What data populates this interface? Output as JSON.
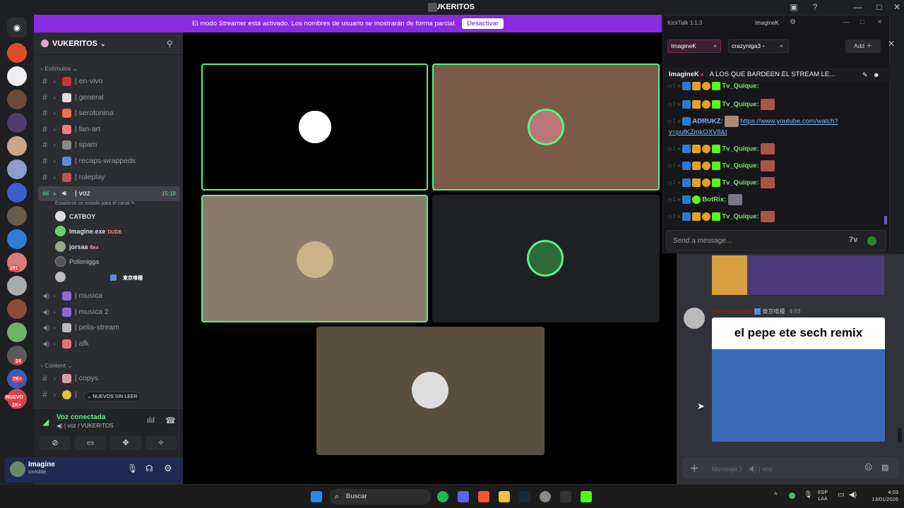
{
  "window": {
    "title": "VUKERITOS",
    "minimize": "—",
    "maximize": "□",
    "close": "✕"
  },
  "banner": {
    "text": "El modo Streamer está activado. Los nombres de usuario se mostrarán de forma parcial.",
    "button": "Desactivar"
  },
  "server": {
    "name": "VUKERITOS"
  },
  "rail": {
    "badges": [
      "281",
      "24",
      "7K+",
      "NUEVO",
      "1K+"
    ]
  },
  "sidebar": {
    "categories": [
      {
        "label": "Estímulos"
      },
      {
        "label": "Content"
      }
    ],
    "text_channels": [
      "| en-vivo",
      "| general",
      "| serotonina",
      "| fan-art",
      "| spam",
      "| recaps-wrappeds",
      "| roleplay"
    ],
    "voice_channel": {
      "name": "| voz",
      "time": "15:18",
      "status": "Establece un estado para el canal"
    },
    "voice_users": [
      {
        "name": "CATBOY",
        "tag": ""
      },
      {
        "name": "Imagine.exe",
        "tag": "DUDE"
      },
      {
        "name": "jorsaa",
        "tag": "flex"
      },
      {
        "name": "Pollonigga",
        "tag": ""
      },
      {
        "name": "",
        "tag": "東京喰種"
      }
    ],
    "voice_channels": [
      "| musica",
      "| musica 2",
      "| pelis-stream",
      "| afk"
    ],
    "content_channels": [
      "| copys",
      "|"
    ],
    "new_unread": "NUEVOS SIN LEER"
  },
  "voice": {
    "status": "Voz conectada",
    "location": "voz / VUKERITOS"
  },
  "user": {
    "name": "Imagine",
    "status": "Invisible"
  },
  "kicktalk": {
    "title": "KickTalk 1.1.3",
    "account": "ImagineK",
    "tabs": [
      {
        "label": "ImagineK"
      },
      {
        "label": "crazyniga3"
      }
    ],
    "add_button": "Add",
    "pinned": {
      "user": "ImagineK",
      "text": "A LOS QUE BARDEEN EL STREAM LE..."
    },
    "messages": [
      {
        "user": "Tv_Quique:",
        "link": ""
      },
      {
        "user": "Tv_Quique:",
        "link": ""
      },
      {
        "user": "ADRUKZ:",
        "link": "https://www.youtube.com/watch?",
        "link2": "v=pufKZmkOXV8&t"
      },
      {
        "user": "Tv_Quique:",
        "link": ""
      },
      {
        "user": "Tv_Quique:",
        "link": ""
      },
      {
        "user": "Tv_Quique:",
        "link": ""
      },
      {
        "user": "BotRix:",
        "link": ""
      },
      {
        "user": "Tv_Quique:",
        "link": ""
      }
    ],
    "input_placeholder": "Send a message..."
  },
  "chat": {
    "message": {
      "tag": "東京喰種",
      "time": "4:03",
      "image_caption": "el pepe ete sech remix"
    },
    "input_placeholder": "Mensaje",
    "input_channel": "| voz"
  },
  "taskbar": {
    "search": "Buscar",
    "lang1": "ESP",
    "lang2": "LAA",
    "time": "4:03",
    "date": "13/01/2026"
  },
  "colors": {
    "banner": "#8a2be2",
    "speaking_border": "#57f287",
    "kick_green": "#53fc18"
  }
}
